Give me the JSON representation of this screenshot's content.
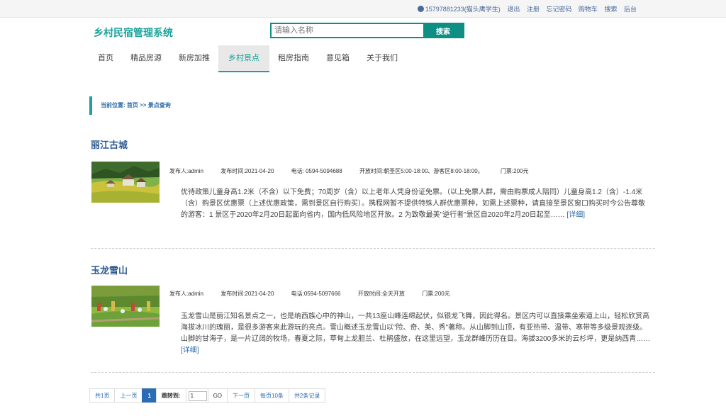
{
  "topbar": {
    "user": "15797881233(猫头鹰学生)",
    "logout": "退出",
    "register": "注册",
    "forgot_password": "忘记密码",
    "cart": "购物车",
    "search": "搜索",
    "admin": "后台"
  },
  "header": {
    "logo": "乡村民宿管理系统",
    "search_placeholder": "请输入名称",
    "search_button": "搜索"
  },
  "nav": {
    "items": [
      "首页",
      "精品房源",
      "新房加推",
      "乡村景点",
      "租房指南",
      "意见箱",
      "关于我们"
    ],
    "active": "乡村景点"
  },
  "breadcrumb": {
    "prefix": "当前位置:",
    "path": "首页 >> 景点查询"
  },
  "spots": [
    {
      "title": "丽江古城",
      "publisher": "发布人:admin",
      "time": "发布时间:2021-04-20",
      "phone": "电话: 0594-5094688",
      "open": "开放时间:朝圣区5:00-18:00、游客区8:00-18:00。",
      "ticket": "门票:200元",
      "desc": "优待政策儿童身高1.2米（不含）以下免费；70周岁（含）以上老年人凭身份证免票。（以上免票人群，需由购票成人陪同）儿童身高1.2（含）-1.4米（含）购景区优惠票（上述优惠政策，需到景区自行购买）。携程网暂不提供特殊人群优惠票种，如需上述票种，请直接至景区窗口购买时今公告尊敬的游客：1 景区于2020年2月20日起面向省内，国内低风险地区开放。2 为致敬最美\"逆行者\"景区自2020年2月20日起至……",
      "detail": "[详细]"
    },
    {
      "title": "玉龙雪山",
      "publisher": "发布人:admin",
      "time": "发布时间:2021-04-20",
      "phone": "电话:0594-5097666",
      "open": "开放时间:全天开放",
      "ticket": "门票:200元",
      "desc": "玉龙雪山是丽江知名景点之一，也是纳西族心中的神山，一共13座山峰连绵起伏，似银龙飞舞，因此得名。景区内可以直接乘坐索道上山，轻松欣赏高海拔冰川的瑰丽，是很多游客来此游玩的亮点。雪山概述玉龙雪山以\"险、奇、美、秀\"著称。从山脚到山顶，有亚热带、温带、寒带等多级景观逐级。山脚的甘海子，是一片辽阔的牧场，春夏之际，草甸上龙胆兰、杜鹃盛放，在这里远望，玉龙群峰历历在目。海拔3200多米的云杉坪，更是纳西青……",
      "detail": "[详细]"
    }
  ],
  "pager": {
    "total_pages": "共1页",
    "prev": "上一页",
    "current": "1",
    "jump_label": "跳转到:",
    "jump_value": "1",
    "go": "GO",
    "next": "下一页",
    "per_page": "每页10条",
    "total": "共2条记录"
  }
}
